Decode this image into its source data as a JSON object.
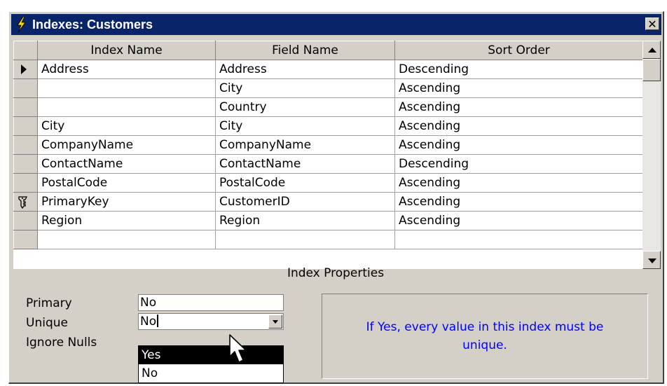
{
  "window": {
    "title": "Indexes: Customers",
    "close_glyph": "✕",
    "icon": "lightning-bolt-icon"
  },
  "grid": {
    "columns": [
      "Index Name",
      "Field Name",
      "Sort Order"
    ],
    "rows": [
      {
        "marker": "current-row-arrow",
        "index_name": "Address",
        "field_name": "Address",
        "sort_order": "Descending"
      },
      {
        "marker": "",
        "index_name": "",
        "field_name": "City",
        "sort_order": "Ascending"
      },
      {
        "marker": "",
        "index_name": "",
        "field_name": "Country",
        "sort_order": "Ascending"
      },
      {
        "marker": "",
        "index_name": "City",
        "field_name": "City",
        "sort_order": "Ascending"
      },
      {
        "marker": "",
        "index_name": "CompanyName",
        "field_name": "CompanyName",
        "sort_order": "Ascending"
      },
      {
        "marker": "",
        "index_name": "ContactName",
        "field_name": "ContactName",
        "sort_order": "Descending"
      },
      {
        "marker": "",
        "index_name": "PostalCode",
        "field_name": "PostalCode",
        "sort_order": "Ascending"
      },
      {
        "marker": "primary-key",
        "index_name": "PrimaryKey",
        "field_name": "CustomerID",
        "sort_order": "Ascending"
      },
      {
        "marker": "",
        "index_name": "Region",
        "field_name": "Region",
        "sort_order": "Ascending"
      },
      {
        "marker": "",
        "index_name": "",
        "field_name": "",
        "sort_order": ""
      }
    ]
  },
  "index_properties": {
    "header": "Index Properties",
    "primary": {
      "label": "Primary",
      "value": "No"
    },
    "unique": {
      "label": "Unique",
      "value": "No"
    },
    "ignore_nulls": {
      "label": "Ignore Nulls"
    },
    "dropdown_options": [
      "Yes",
      "No"
    ],
    "highlighted_option": "Yes",
    "help_text": "If Yes, every value in this index must be unique."
  },
  "colors": {
    "titlebar": "#0a246a",
    "face": "#d4d0c8",
    "help_text": "#0000ff",
    "highlight": "#000000"
  }
}
